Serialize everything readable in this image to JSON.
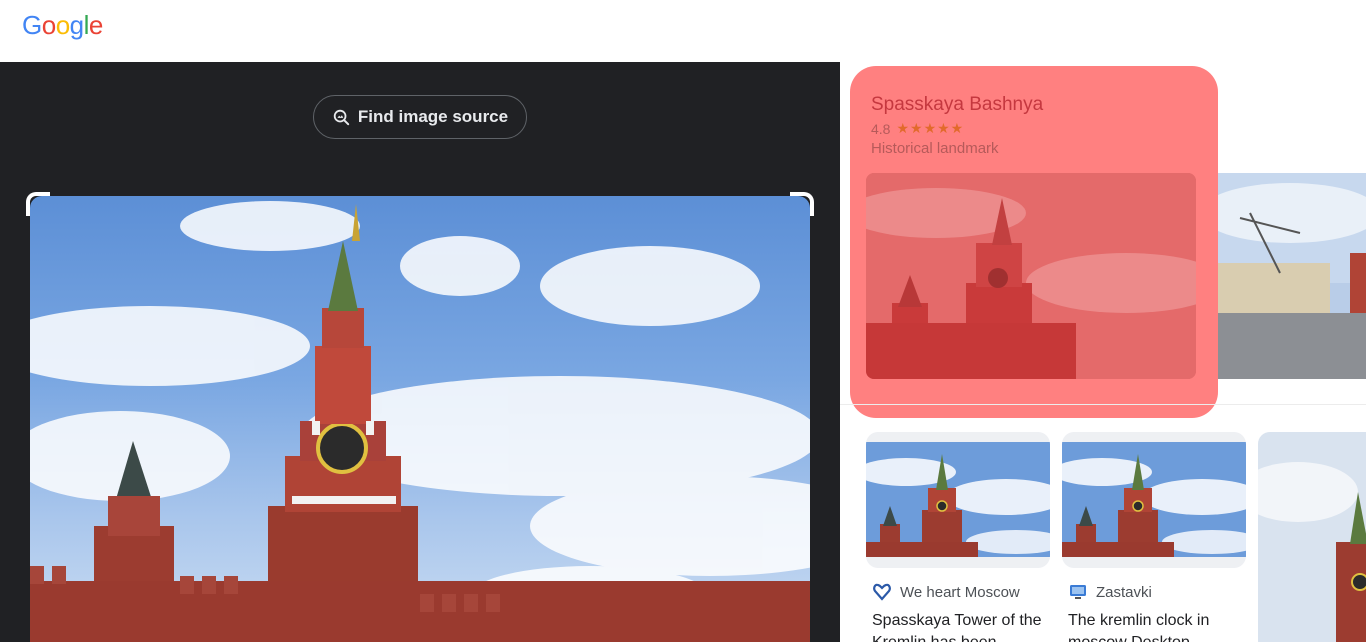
{
  "header": {
    "logo_letters": [
      {
        "char": "G",
        "color": "#4285f4"
      },
      {
        "char": "o",
        "color": "#ea4335"
      },
      {
        "char": "o",
        "color": "#fbbc05"
      },
      {
        "char": "g",
        "color": "#4285f4"
      },
      {
        "char": "l",
        "color": "#34a853"
      },
      {
        "char": "e",
        "color": "#ea4335"
      }
    ]
  },
  "viewer": {
    "find_source_label": "Find image source",
    "find_source_icon": "image-search-icon"
  },
  "knowledge_panel": {
    "title": "Spasskaya Bashnya",
    "rating": "4.8",
    "stars": "★★★★★",
    "type": "Historical landmark"
  },
  "results": [
    {
      "source": "We heart Moscow",
      "source_icon": "heart-logo-icon",
      "caption": "Spasskaya Tower of the Kremlin has been"
    },
    {
      "source": "Zastavki",
      "source_icon": "monitor-logo-icon",
      "caption": "The kremlin clock in moscow Desktop"
    }
  ],
  "colors": {
    "dark_panel": "#202124",
    "highlight": "#ff8080",
    "title_red": "#c5383f",
    "star_orange": "#e26a2c"
  }
}
